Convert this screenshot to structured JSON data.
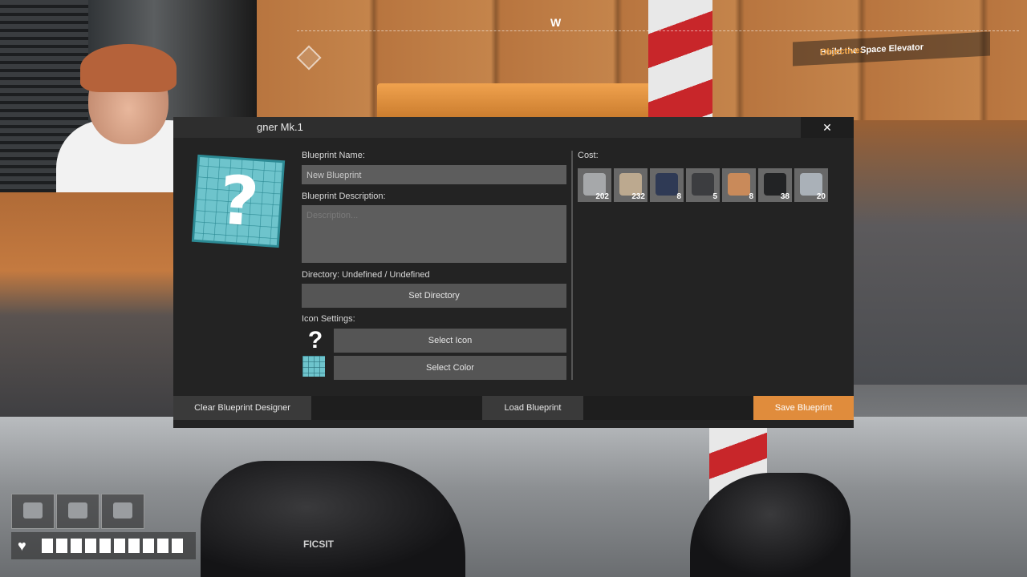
{
  "game_hud": {
    "compass_heading": "W",
    "objective_label": "Objective:",
    "objective_text": "Build the Space Elevator",
    "glove_logo": "FICSIT"
  },
  "dialog": {
    "title": "gner Mk.1",
    "close_symbol": "✕",
    "blueprint_name_label": "Blueprint Name:",
    "blueprint_name_value": "New Blueprint",
    "blueprint_description_label": "Blueprint Description:",
    "blueprint_description_placeholder": "Description...",
    "directory_label": "Directory: Undefined / Undefined",
    "set_directory_button": "Set Directory",
    "icon_settings_label": "Icon Settings:",
    "icon_preview_symbol": "?",
    "select_icon_button": "Select Icon",
    "select_color_button": "Select Color",
    "cost_label": "Cost:",
    "cost_items": [
      {
        "icon": "plate-icon",
        "quantity": "202",
        "color": "#a6a8aa"
      },
      {
        "icon": "concrete-icon",
        "quantity": "232",
        "color": "#bca98f"
      },
      {
        "icon": "motor-icon",
        "quantity": "8",
        "color": "#2f3a55"
      },
      {
        "icon": "steel-pipe-icon",
        "quantity": "5",
        "color": "#3c3d40"
      },
      {
        "icon": "copper-wire-icon",
        "quantity": "8",
        "color": "#c98a5a"
      },
      {
        "icon": "cable-icon",
        "quantity": "38",
        "color": "#222325"
      },
      {
        "icon": "sheet-icon",
        "quantity": "20",
        "color": "#aab1b8"
      }
    ],
    "clear_button": "Clear Blueprint Designer",
    "load_button": "Load Blueprint",
    "save_button": "Save Blueprint",
    "accent_color": "#e08c3c",
    "icon_color": "#6ec4cc"
  }
}
